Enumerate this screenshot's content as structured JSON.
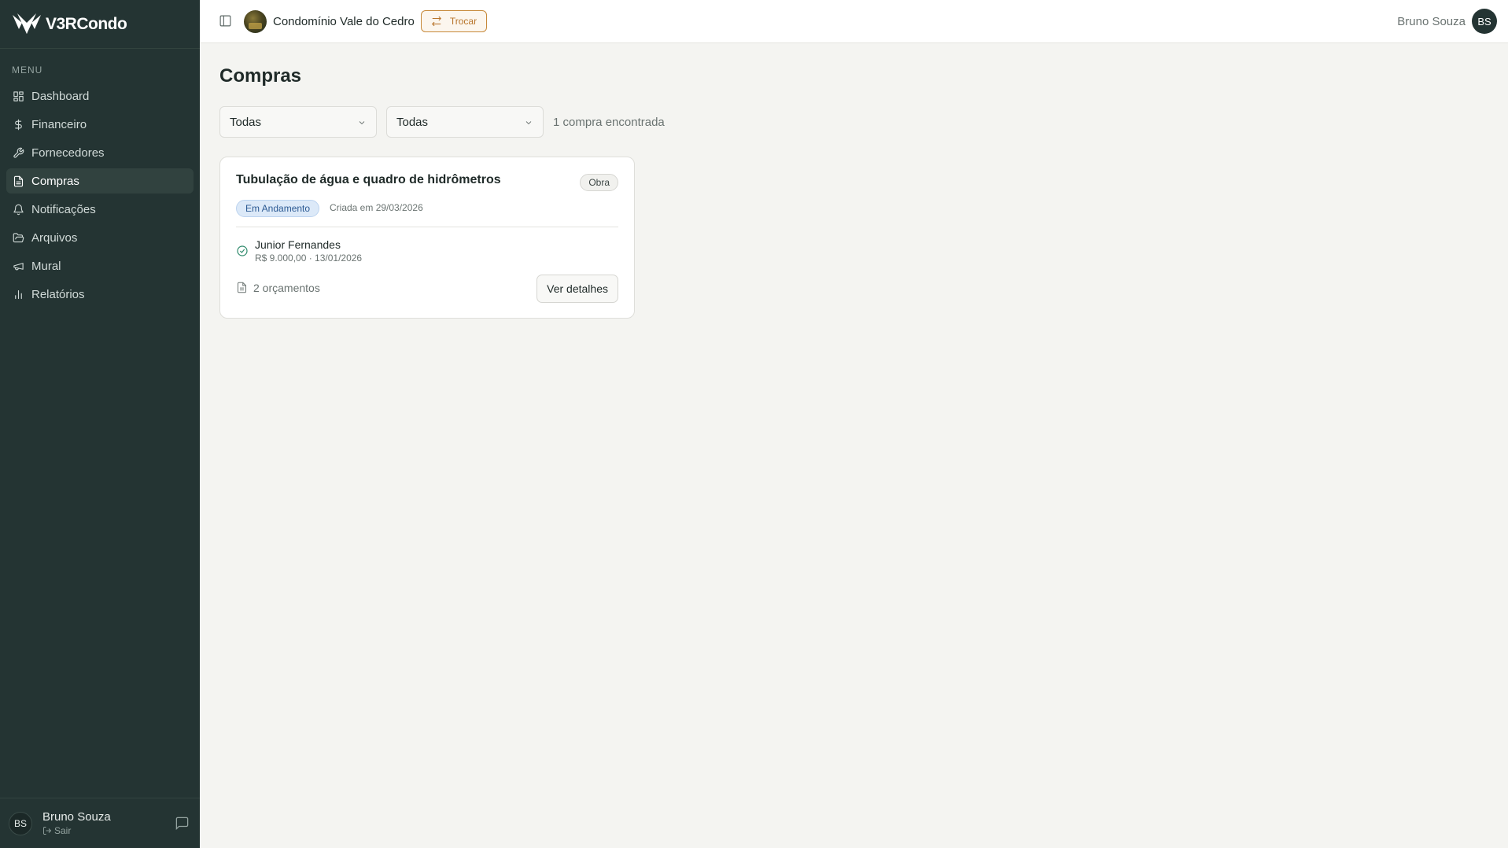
{
  "brand": {
    "name": "V3RCondo"
  },
  "sidebar": {
    "menu_label": "MENU",
    "items": [
      {
        "label": "Dashboard",
        "icon": "dashboard-icon",
        "active": false
      },
      {
        "label": "Financeiro",
        "icon": "dollar-icon",
        "active": false
      },
      {
        "label": "Fornecedores",
        "icon": "wrench-icon",
        "active": false
      },
      {
        "label": "Compras",
        "icon": "document-icon",
        "active": true
      },
      {
        "label": "Notificações",
        "icon": "bell-icon",
        "active": false
      },
      {
        "label": "Arquivos",
        "icon": "folder-icon",
        "active": false
      },
      {
        "label": "Mural",
        "icon": "megaphone-icon",
        "active": false
      },
      {
        "label": "Relatórios",
        "icon": "bar-chart-icon",
        "active": false
      }
    ],
    "footer": {
      "initials": "BS",
      "name": "Bruno Souza",
      "logout": "Sair"
    }
  },
  "header": {
    "condo_name": "Condomínio Vale do Cedro",
    "switch_label": "Trocar",
    "user_name": "Bruno Souza",
    "user_initials": "BS"
  },
  "main": {
    "title": "Compras",
    "filters": [
      {
        "selected": "Todas"
      },
      {
        "selected": "Todas"
      }
    ],
    "result_count": "1 compra encontrada",
    "cards": [
      {
        "title": "Tubulação de água e quadro de hidrômetros",
        "type": "Obra",
        "status": "Em Andamento",
        "created": "Criada em 29/03/2026",
        "supplier": "Junior Fernandes",
        "supplier_meta": "R$ 9.000,00 · 13/01/2026",
        "quotes": "2 orçamentos",
        "details_label": "Ver detalhes"
      }
    ]
  },
  "colors": {
    "sidebar_bg": "#243433",
    "accent_orange": "#c7893a",
    "status_blue": "#2c5a93",
    "success_green": "#2f8a6c"
  }
}
